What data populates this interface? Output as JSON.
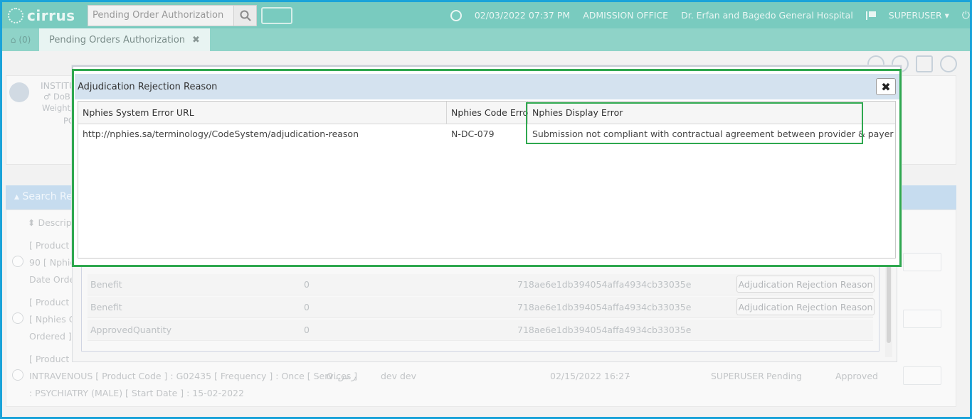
{
  "app": {
    "logo": "cirrus",
    "search_value": "Pending Order Authorization",
    "datetime": "02/03/2022 07:37 PM",
    "department": "ADMISSION OFFICE",
    "hospital": "Dr. Erfan and Bagedo General Hospital",
    "user": "SUPERUSER ▾"
  },
  "tabs": {
    "home_count": "(0)",
    "active_tab": "Pending Orders Authorization",
    "close_glyph": "✖"
  },
  "background": {
    "patient_label": "INSTITU",
    "dob_label": "♂ DoB",
    "weight_label": "Weight/H",
    "po_label": "PO",
    "search_results_label": "▴ Search Re",
    "desc_header": "⬍ Descript",
    "rows": [
      {
        "line1": "[ Product N",
        "line2": "90 [ Nphie",
        "line3": "Date Order"
      },
      {
        "line1": "[ Product N",
        "line2": "[ Nphies Co",
        "line3": "Ordered ] :"
      },
      {
        "line1": "[ Product N",
        "line2": "INTRAVENOUS [ Product Code ] : G02435 [ Frequency ] : Once [ Services ]",
        "line3": ": PSYCHIATRY (MALE) [ Start Date ] : 15-02-2022"
      }
    ],
    "row3_price": "0 .ر.س",
    "row3_doctor": "dev dev",
    "row3_date": "02/15/2022 16:27",
    "row3_dash": "-",
    "row3_user": "SUPERUSER",
    "row3_status1": "Pending",
    "row3_status2": "Approved",
    "details": [
      {
        "name": "Benefit",
        "value": "0",
        "id": "718ae6e1db394054affa4934cb33035e",
        "button": "Adjudication Rejection Reason"
      },
      {
        "name": "Benefit",
        "value": "0",
        "id": "718ae6e1db394054affa4934cb33035e",
        "button": "Adjudication Rejection Reason"
      },
      {
        "name": "ApprovedQuantity",
        "value": "0",
        "id": "718ae6e1db394054affa4934cb33035e",
        "button": ""
      }
    ]
  },
  "modal": {
    "title": "Adjudication Rejection Reason",
    "close": "✖",
    "columns": [
      "Nphies System Error URL",
      "Nphies Code Error",
      "Nphies Display Error"
    ],
    "rows": [
      {
        "url": "http://nphies.sa/terminology/CodeSystem/adjudication-reason",
        "code": "N-DC-079",
        "display": "Submission not compliant with contractual agreement between provider & payer"
      }
    ]
  }
}
